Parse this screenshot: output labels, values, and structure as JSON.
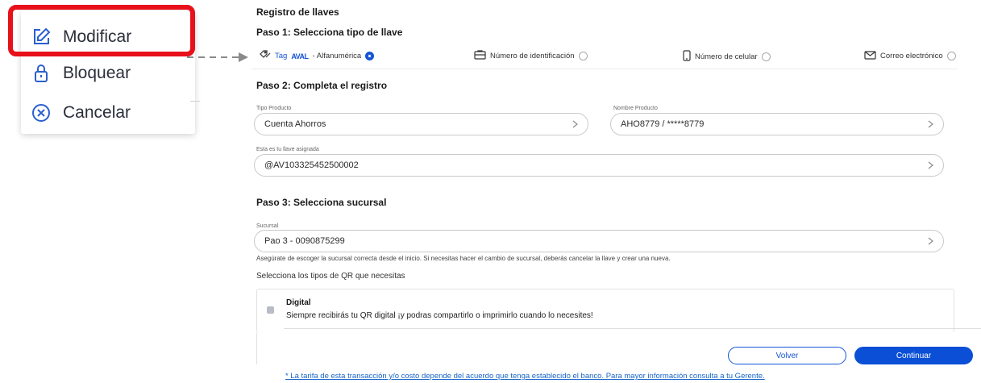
{
  "context_menu": {
    "items": [
      {
        "label": "Modificar",
        "icon": "edit-icon"
      },
      {
        "label": "Bloquear",
        "icon": "lock-icon"
      },
      {
        "label": "Cancelar",
        "icon": "cancel-icon"
      }
    ],
    "highlight_color": "#e8101a"
  },
  "form": {
    "title": "Registro de llaves",
    "step1": {
      "title": "Paso 1: Selecciona tipo de llave",
      "options": [
        {
          "tag": "Tag",
          "brand": "AVAL",
          "label": "- Alfanumérica",
          "selected": true,
          "icon": "tag-icon"
        },
        {
          "label": "Número de identificación",
          "selected": false,
          "icon": "id-card-icon"
        },
        {
          "label": "Número de celular",
          "selected": false,
          "icon": "phone-icon"
        },
        {
          "label": "Correo electrónico",
          "selected": false,
          "icon": "mail-icon"
        }
      ]
    },
    "step2": {
      "title": "Paso 2: Completa el registro",
      "tipo_producto_label": "Tipo Producto",
      "tipo_producto_value": "Cuenta Ahorros",
      "nombre_producto_label": "Nombre Producto",
      "nombre_producto_value": "AHO8779 / *****8779",
      "llave_label": "Esta es tu llave asignada",
      "llave_value": "@AV103325452500002"
    },
    "step3": {
      "title": "Paso 3: Selecciona sucursal",
      "sucursal_label": "Sucursal",
      "sucursal_value": "Pao 3 - 0090875299",
      "hint": "Asegúrate de escoger la sucursal correcta desde el inicio. Si necesitas hacer el cambio de sucursal, deberás cancelar la llave y crear una nueva.",
      "qr_title": "Selecciona los tipos de QR que necesitas",
      "qr_option_title": "Digital",
      "qr_option_desc": "Siempre recibirás tu QR digital ¡y podras compartirlo o imprimirlo cuando lo necesites!"
    },
    "buttons": {
      "back": "Volver",
      "next": "Continuar"
    },
    "footer_note": "* La tarifa de esta transacción y/o costo depende del acuerdo que tenga establecido el banco. Para mayor información consulta a tu Gerente.",
    "accent_color": "#1453d6"
  }
}
